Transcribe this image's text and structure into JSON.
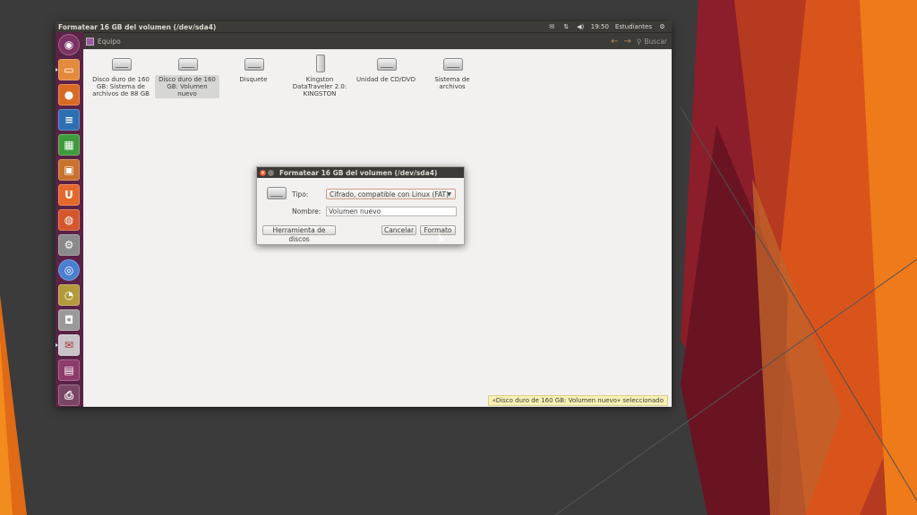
{
  "window": {
    "title": "Formatear 16 GB del volumen (/dev/sda4)",
    "location_label": "Equipo",
    "search_label": "Buscar"
  },
  "tray": {
    "time": "19:50",
    "user": "Estudiantes"
  },
  "devices": [
    {
      "label": "Disco duro de 160 GB: Sistema de archivos de 88 GB",
      "icon": "hdd-icon"
    },
    {
      "label": "Disco duro de 160 GB: Volumen nuevo",
      "icon": "hdd-icon",
      "selected": true
    },
    {
      "label": "Disquete",
      "icon": "floppy-icon"
    },
    {
      "label": "Kingston DataTraveler 2.0: KINGSTON",
      "icon": "usb-icon"
    },
    {
      "label": "Unidad de CD/DVD",
      "icon": "cdrom-icon"
    },
    {
      "label": "Sistema de archivos",
      "icon": "filesystem-icon"
    }
  ],
  "status_bar": "«Disco duro de 160 GB: Volumen nuevo» seleccionado",
  "dialog": {
    "title": "Formatear 16 GB del volumen (/dev/sda4)",
    "type_label": "Tipo:",
    "type_value": "Cifrado, compatible con Linux (FAT)",
    "name_label": "Nombre:",
    "name_value": "Volumen nuevo",
    "disk_tool_button": "Herramienta de discos",
    "cancel_button": "Cancelar",
    "format_button": "Formato"
  },
  "launcher_items": [
    "dash-icon",
    "files-icon",
    "firefox-icon",
    "writer-icon",
    "calc-icon",
    "impress-icon",
    "software-center-icon",
    "ubuntu-one-icon",
    "settings-icon",
    "chrome-icon",
    "disk-usage-icon",
    "screenshot-icon",
    "mail-icon",
    "presentation-icon",
    "printer-icon"
  ],
  "colors": {
    "launcher": "#5a2246",
    "titlebar": "#3c3b37",
    "accent": "#e8562a",
    "status_bg": "#f6f0b4"
  }
}
